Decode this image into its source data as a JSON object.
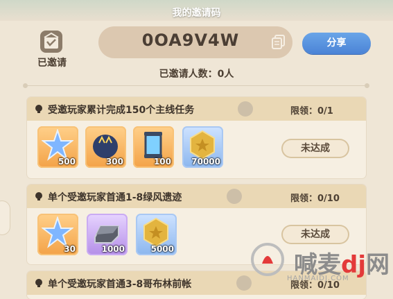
{
  "header": {
    "title": "我的邀请码"
  },
  "invited": {
    "label": "已邀请",
    "icon": "invited-badge-icon"
  },
  "invite_code": {
    "value": "0OA9V4W",
    "copy_icon": "copy-icon"
  },
  "share_button": {
    "label": "分享",
    "color": "#4b83d6"
  },
  "invited_count": {
    "text": "已邀请人数：0人"
  },
  "tasks": [
    {
      "title": "受邀玩家累计完成150个主线任务",
      "limit": "限领：0/1",
      "status": "未达成",
      "rewards": [
        {
          "icon": "blue-star-crystal-icon",
          "qty": "500",
          "rarity": "orange"
        },
        {
          "icon": "cat-egg-icon",
          "qty": "300",
          "rarity": "orange"
        },
        {
          "icon": "blue-capsule-icon",
          "qty": "100",
          "rarity": "orange"
        },
        {
          "icon": "gold-coin-icon",
          "qty": "70000",
          "rarity": "blue"
        }
      ]
    },
    {
      "title": "单个受邀玩家首通1-8绿风遗迹",
      "limit": "限领：0/10",
      "status": "未达成",
      "rewards": [
        {
          "icon": "blue-star-crystal-icon",
          "qty": "30",
          "rarity": "orange"
        },
        {
          "icon": "iron-ingot-icon",
          "qty": "1000",
          "rarity": "purple"
        },
        {
          "icon": "gold-coin-icon",
          "qty": "5000",
          "rarity": "blue"
        }
      ]
    },
    {
      "title": "单个受邀玩家首通3-8哥布林前帐",
      "limit": "限领：0/10"
    }
  ],
  "watermark": {
    "brand_left": "喊麦",
    "brand_mid": "dj",
    "brand_right": "网",
    "url": "HANMAIDJ.COM"
  }
}
